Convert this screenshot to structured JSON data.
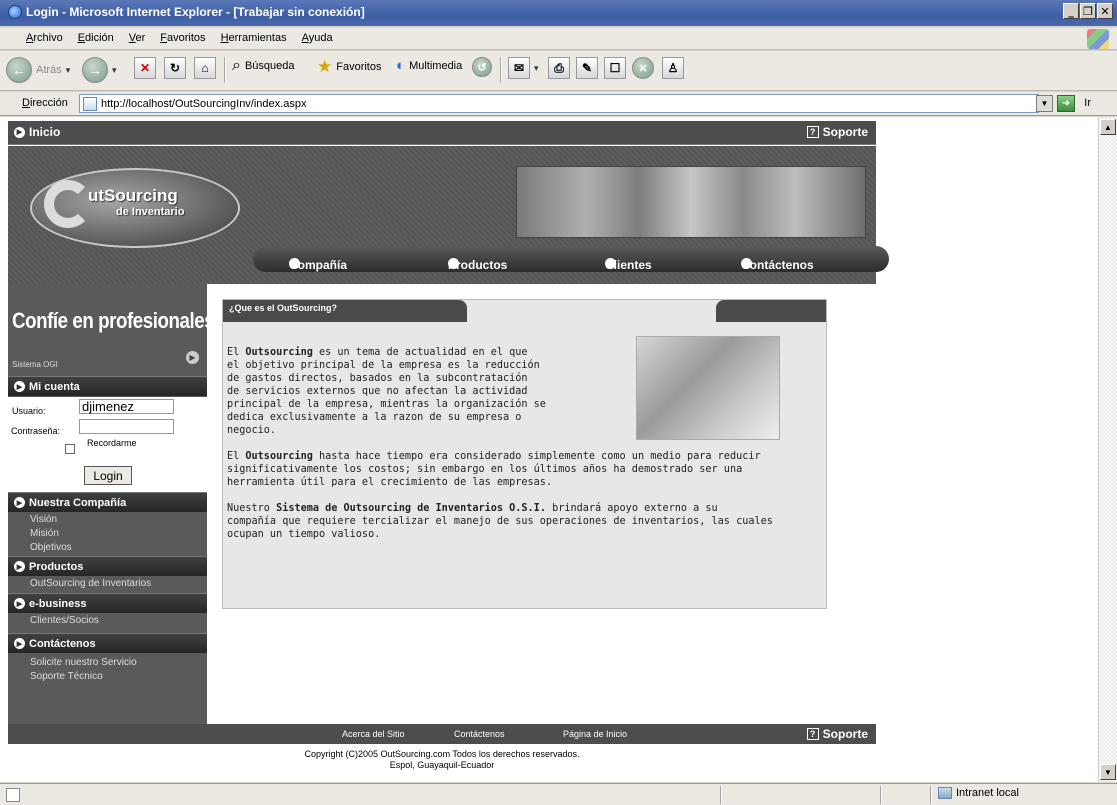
{
  "window": {
    "title": "Login - Microsoft Internet Explorer - [Trabajar sin conexión]"
  },
  "menu": [
    "Archivo",
    "Edición",
    "Ver",
    "Favoritos",
    "Herramientas",
    "Ayuda"
  ],
  "toolbar": {
    "back": "Atrás",
    "search": "Búsqueda",
    "favorites": "Favoritos",
    "media": "Multimedia"
  },
  "address": {
    "label": "Dirección",
    "url": "http://localhost/OutSourcingInv/index.aspx",
    "go": "Ir"
  },
  "site": {
    "topnav": {
      "home": "Inicio",
      "support": "Soporte"
    },
    "logo": {
      "line1": "utSourcing",
      "line2": "de Inventario"
    },
    "mainnav": [
      "Compañía",
      "Productos",
      "Clientes",
      "Contáctenos"
    ],
    "sidebar": {
      "slogan": "Confíe en profesionales",
      "system": "Sistema OGI",
      "account_header": "Mi cuenta",
      "user_label": "Usuario:",
      "user_value": "djimenez",
      "password_label": "Contraseña:",
      "remember_label": "Recordarme",
      "login_button": "Login",
      "sections": [
        {
          "title": "Nuestra Compañía",
          "items": [
            "Visión",
            "Misión",
            "Objetivos"
          ]
        },
        {
          "title": "Productos",
          "items": [
            "OutSourcing de Inventarios"
          ]
        },
        {
          "title": "e-business",
          "items": [
            "Clientes/Socios"
          ]
        },
        {
          "title": "Contáctenos",
          "items": [
            "Solicite nuestro Servicio",
            "Soporte Técnico"
          ]
        }
      ]
    },
    "content": {
      "tab_title": "¿Que es el OutSourcing?",
      "p1_lines": [
        [
          "El ",
          "Outsourcing",
          " es un tema de actualidad en el que"
        ],
        [
          "el objetivo principal de la empresa es la reducción"
        ],
        [
          "de gastos directos, basados en la subcontratación"
        ],
        [
          "de servicios externos que no afectan la actividad"
        ],
        [
          "principal de la empresa, mientras la organización se"
        ],
        [
          "dedica exclusivamente a la razon de su empresa o"
        ],
        [
          "negocio."
        ]
      ],
      "p2_lines": [
        [
          "El ",
          "Outsourcing",
          " hasta hace tiempo era considerado simplemente como un medio para reducir"
        ],
        [
          "significativamente los costos; sin embargo en los últimos años ha demostrado ser una"
        ],
        [
          "herramienta útil para el crecimiento de las empresas."
        ]
      ],
      "p3_lines": [
        [
          "Nuestro ",
          "Sistema de Outsourcing de Inventarios O.S.I.",
          " brindará apoyo externo a su"
        ],
        [
          "compañía que requiere tercializar el manejo de sus operaciones de inventarios, las cuales"
        ],
        [
          "ocupan un tiempo valioso."
        ]
      ]
    },
    "footer": {
      "links": [
        "Acerca del Sitio",
        "Contáctenos",
        "Página de Inicio"
      ],
      "support": "Soporte",
      "copyright": "Copyright (C)2005 OutSourcing.com Todos los derechos reservados.",
      "location": "Espol, Guayaquil-Ecuador"
    }
  },
  "status": {
    "zone": "Intranet local"
  }
}
